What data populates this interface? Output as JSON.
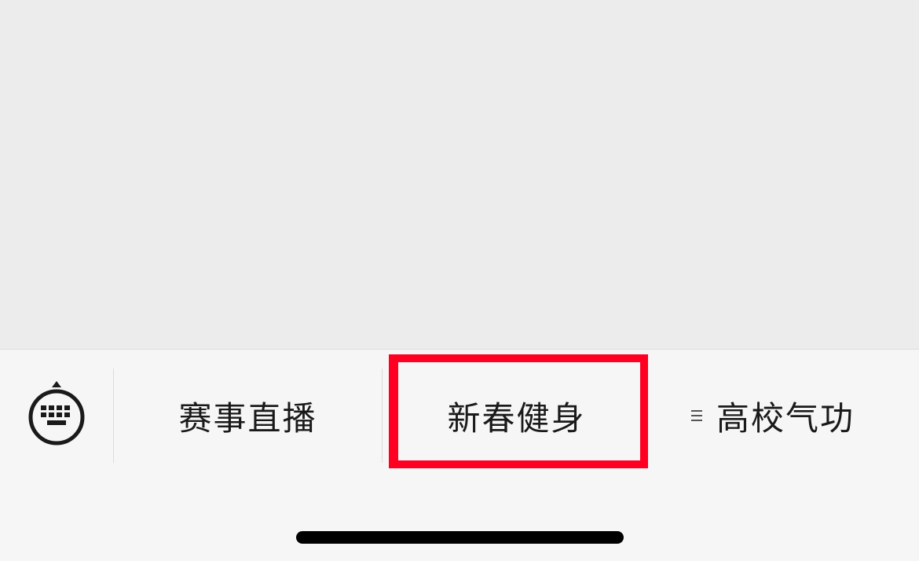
{
  "menu": {
    "items": [
      {
        "label": "赛事直播",
        "has_submenu": false
      },
      {
        "label": "新春健身",
        "has_submenu": false
      },
      {
        "label": "高校气功",
        "has_submenu": true
      }
    ]
  },
  "icons": {
    "keyboard_toggle": "keyboard-icon",
    "submenu": "menu-lines-icon"
  },
  "colors": {
    "highlight": "#ff0022",
    "bar_background": "#f6f6f6",
    "content_background": "#ececec"
  }
}
